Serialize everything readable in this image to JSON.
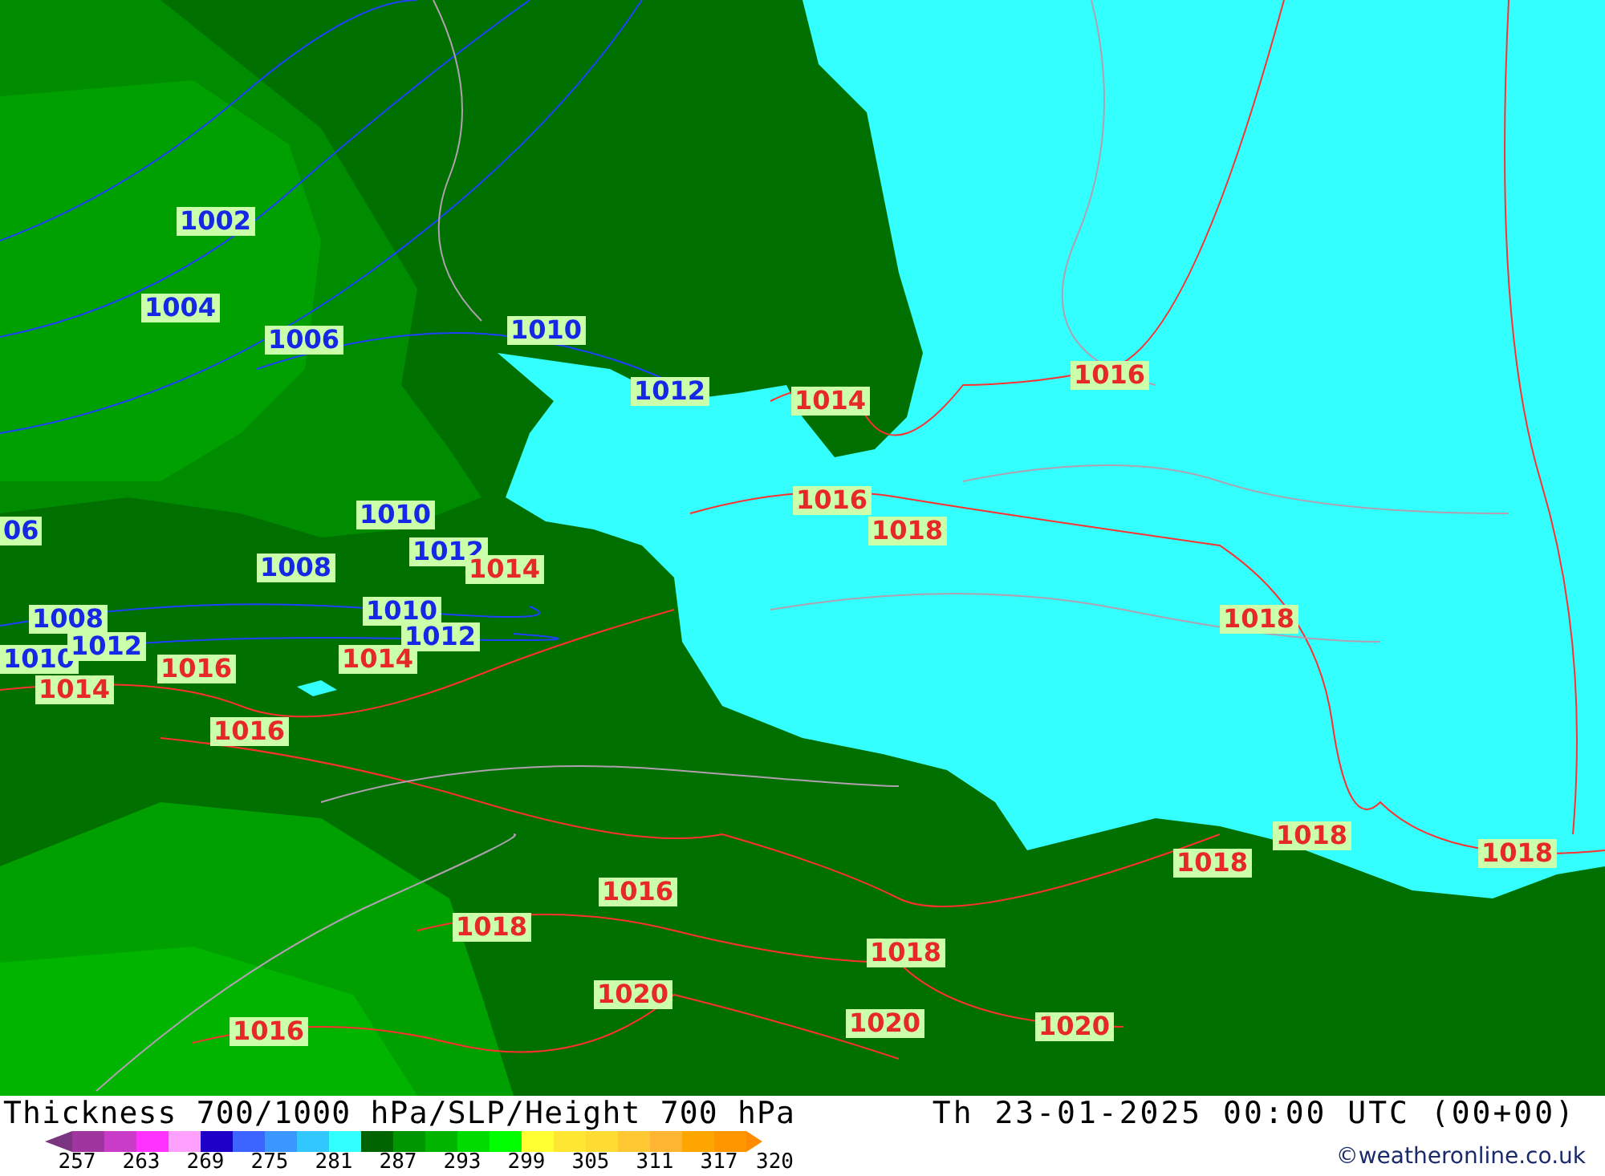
{
  "map": {
    "labels": [
      {
        "text": "1002",
        "kind": "low"
      },
      {
        "text": "1004",
        "kind": "low"
      },
      {
        "text": "1006",
        "kind": "low"
      },
      {
        "text": "1010",
        "kind": "low"
      },
      {
        "text": "1012",
        "kind": "low"
      },
      {
        "text": "1014",
        "kind": "high"
      },
      {
        "text": "1016",
        "kind": "high"
      },
      {
        "text": "06",
        "kind": "low"
      },
      {
        "text": "1010",
        "kind": "low"
      },
      {
        "text": "1012",
        "kind": "low"
      },
      {
        "text": "1014",
        "kind": "high"
      },
      {
        "text": "1008",
        "kind": "low"
      },
      {
        "text": "1016",
        "kind": "high"
      },
      {
        "text": "1018",
        "kind": "high"
      },
      {
        "text": "1008",
        "kind": "low"
      },
      {
        "text": "1010",
        "kind": "low"
      },
      {
        "text": "1012",
        "kind": "low"
      },
      {
        "text": "1018",
        "kind": "high"
      },
      {
        "text": "1010",
        "kind": "low"
      },
      {
        "text": "1012",
        "kind": "low"
      },
      {
        "text": "1016",
        "kind": "high"
      },
      {
        "text": "1014",
        "kind": "high"
      },
      {
        "text": "1014",
        "kind": "high"
      },
      {
        "text": "1016",
        "kind": "high"
      },
      {
        "text": "1018",
        "kind": "high"
      },
      {
        "text": "1018",
        "kind": "high"
      },
      {
        "text": "1018",
        "kind": "high"
      },
      {
        "text": "1016",
        "kind": "high"
      },
      {
        "text": "1018",
        "kind": "high"
      },
      {
        "text": "1018",
        "kind": "high"
      },
      {
        "text": "1020",
        "kind": "high"
      },
      {
        "text": "1016",
        "kind": "high"
      },
      {
        "text": "1020",
        "kind": "high"
      },
      {
        "text": "1020",
        "kind": "high"
      }
    ]
  },
  "footer": {
    "title": "Thickness 700/1000 hPa/SLP/Height 700 hPa",
    "datetime": "Th 23-01-2025 00:00 UTC (00+00)",
    "credit": "©weatheronline.co.uk"
  },
  "legend": {
    "swatches": [
      {
        "kind": "start",
        "color": "#7a3580"
      },
      {
        "kind": "band",
        "color": "#a035a0"
      },
      {
        "kind": "band",
        "color": "#c83cc8"
      },
      {
        "kind": "band",
        "color": "#ff32ff"
      },
      {
        "kind": "band",
        "color": "#ffa0ff"
      },
      {
        "kind": "band",
        "color": "#1e00c8"
      },
      {
        "kind": "band",
        "color": "#3c64ff"
      },
      {
        "kind": "band",
        "color": "#3c96ff"
      },
      {
        "kind": "band",
        "color": "#32c8ff"
      },
      {
        "kind": "band",
        "color": "#32ffff"
      },
      {
        "kind": "band",
        "color": "#006400"
      },
      {
        "kind": "band",
        "color": "#009600"
      },
      {
        "kind": "band",
        "color": "#00b400"
      },
      {
        "kind": "band",
        "color": "#00dc00"
      },
      {
        "kind": "band",
        "color": "#00ff00"
      },
      {
        "kind": "band",
        "color": "#ffff32"
      },
      {
        "kind": "band",
        "color": "#ffe632"
      },
      {
        "kind": "band",
        "color": "#ffdc32"
      },
      {
        "kind": "band",
        "color": "#ffc832"
      },
      {
        "kind": "band",
        "color": "#ffb432"
      },
      {
        "kind": "band",
        "color": "#ffa500"
      },
      {
        "kind": "band",
        "color": "#ff9600"
      },
      {
        "kind": "end",
        "color": "#ff8c00"
      }
    ],
    "ticks": [
      "257",
      "263",
      "269",
      "275",
      "281",
      "287",
      "293",
      "299",
      "305",
      "311",
      "317",
      "320"
    ]
  }
}
